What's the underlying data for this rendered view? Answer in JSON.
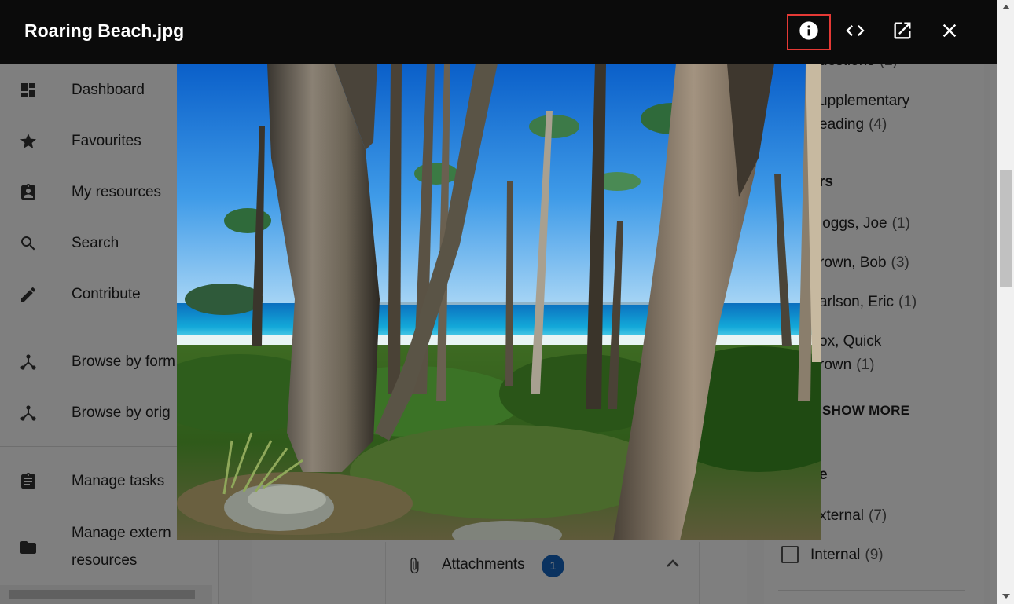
{
  "lightbox": {
    "title": "Roaring Beach.jpg",
    "buttons": {
      "info": "info-icon",
      "embed": "code-icon",
      "open_new": "open-in-new-icon",
      "close": "close-icon"
    },
    "highlight_color": "#e53935"
  },
  "sidebar": {
    "items": [
      {
        "label": "Dashboard",
        "icon": "dashboard-icon"
      },
      {
        "label": "Favourites",
        "icon": "star-icon"
      },
      {
        "label": "My resources",
        "icon": "assignment-ind-icon"
      },
      {
        "label": "Search",
        "icon": "search-icon"
      },
      {
        "label": "Contribute",
        "icon": "pencil-icon"
      },
      {
        "label": "Browse by form",
        "icon": "hierarchy-icon"
      },
      {
        "label": "Browse by origin",
        "icon": "hierarchy-icon"
      },
      {
        "label": "Manage tasks",
        "icon": "clipboard-icon"
      },
      {
        "label": "Manage external resources",
        "icon": "folder-icon"
      }
    ],
    "visible_labels": [
      "Dashboard",
      "Favourites",
      "My resources",
      "Search",
      "Contribute",
      "Browse by form",
      "Browse by orig",
      "Manage tasks",
      "Manage extern",
      "resources"
    ]
  },
  "attachments": {
    "label": "Attachments",
    "count": "1",
    "icon": "paperclip-icon",
    "toggle_icon": "chevron-up-icon",
    "badge_color": "#1565c0"
  },
  "filters": {
    "top_items": [
      {
        "label": "uestions",
        "count": "(2)"
      },
      {
        "label": "upplementary",
        "label2": "eading",
        "count": "(4)"
      }
    ],
    "authors_heading": "rs",
    "authors": [
      {
        "label": "loggs, Joe",
        "count": "(1)"
      },
      {
        "label": "rown, Bob",
        "count": "(3)"
      },
      {
        "label": "arlson, Eric",
        "count": "(1)"
      },
      {
        "label": "ox, Quick",
        "label2": "rown",
        "count": "(1)"
      }
    ],
    "show_more": "SHOW MORE",
    "type_heading": "e",
    "types": [
      {
        "label": "xternal",
        "count": "(7)"
      },
      {
        "label": "Internal",
        "count": "(9)"
      }
    ]
  }
}
